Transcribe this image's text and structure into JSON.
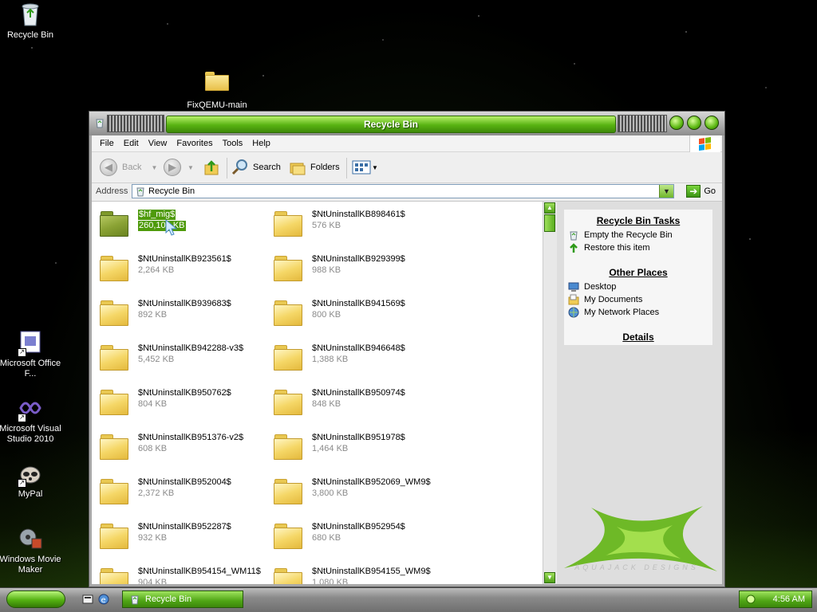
{
  "desktop": {
    "icons": [
      {
        "label": "Recycle Bin"
      },
      {
        "label": "FixQEMU-main"
      },
      {
        "label": "Microsoft Office F..."
      },
      {
        "label": "Microsoft Visual Studio 2010"
      },
      {
        "label": "MyPal"
      },
      {
        "label": "Windows Movie Maker"
      }
    ]
  },
  "window": {
    "title": "Recycle Bin",
    "menu": [
      "File",
      "Edit",
      "View",
      "Favorites",
      "Tools",
      "Help"
    ],
    "toolbar": {
      "back": "Back",
      "search": "Search",
      "folders": "Folders"
    },
    "address": {
      "label": "Address",
      "value": "Recycle Bin",
      "go": "Go"
    },
    "files": [
      {
        "name": "$hf_mig$",
        "size": "260,104 KB",
        "selected": true
      },
      {
        "name": "$NtUninstallKB898461$",
        "size": "576 KB"
      },
      {
        "name": "$NtUninstallKB923561$",
        "size": "2,264 KB"
      },
      {
        "name": "$NtUninstallKB929399$",
        "size": "988 KB"
      },
      {
        "name": "$NtUninstallKB939683$",
        "size": "892 KB"
      },
      {
        "name": "$NtUninstallKB941569$",
        "size": "800 KB"
      },
      {
        "name": "$NtUninstallKB942288-v3$",
        "size": "5,452 KB"
      },
      {
        "name": "$NtUninstallKB946648$",
        "size": "1,388 KB"
      },
      {
        "name": "$NtUninstallKB950762$",
        "size": "804 KB"
      },
      {
        "name": "$NtUninstallKB950974$",
        "size": "848 KB"
      },
      {
        "name": "$NtUninstallKB951376-v2$",
        "size": "608 KB"
      },
      {
        "name": "$NtUninstallKB951978$",
        "size": "1,464 KB"
      },
      {
        "name": "$NtUninstallKB952004$",
        "size": "2,372 KB"
      },
      {
        "name": "$NtUninstallKB952069_WM9$",
        "size": "3,800 KB"
      },
      {
        "name": "$NtUninstallKB952287$",
        "size": "932 KB"
      },
      {
        "name": "$NtUninstallKB952954$",
        "size": "680 KB"
      },
      {
        "name": "$NtUninstallKB954154_WM11$",
        "size": "904 KB"
      },
      {
        "name": "$NtUninstallKB954155_WM9$",
        "size": "1,080 KB"
      }
    ],
    "tasks": {
      "recycle_heading": "Recycle Bin Tasks",
      "empty": "Empty the Recycle Bin",
      "restore": "Restore this item",
      "other_heading": "Other Places",
      "desktop": "Desktop",
      "documents": "My Documents",
      "network": "My Network Places",
      "details": "Details"
    },
    "branding": "AQUAJACK DESIGNS"
  },
  "taskbar": {
    "task_label": "Recycle Bin",
    "clock": "4:56 AM"
  }
}
